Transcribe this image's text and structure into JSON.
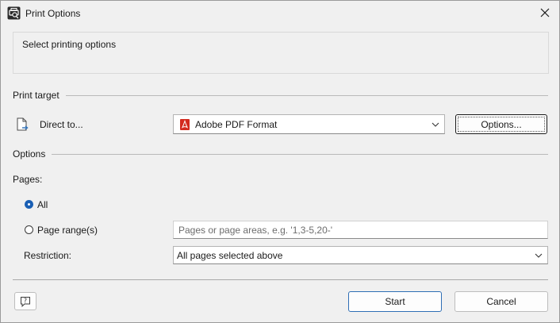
{
  "window": {
    "title": "Print Options"
  },
  "description": {
    "text": "Select printing options"
  },
  "print_target": {
    "group_label": "Print target",
    "direct_to_label": "Direct to...",
    "printer_value": "Adobe PDF Format",
    "options_button": "Options..."
  },
  "options": {
    "group_label": "Options",
    "pages_label": "Pages:",
    "radio_all": "All",
    "radio_page_range": "Page range(s)",
    "page_range_placeholder": "Pages or page areas, e.g. '1,3-5,20-'",
    "restriction_label": "Restriction:",
    "restriction_value": "All pages selected above",
    "selected": "all"
  },
  "footer": {
    "start_button": "Start",
    "cancel_button": "Cancel"
  },
  "colors": {
    "accent": "#1a5fb4",
    "pdf_red": "#d32a1e"
  },
  "icons": {
    "app": "print-options-app-icon",
    "close": "close-icon",
    "direct": "export-document-icon",
    "pdf": "adobe-pdf-icon",
    "chevron": "chevron-down-icon",
    "help": "help-icon"
  }
}
